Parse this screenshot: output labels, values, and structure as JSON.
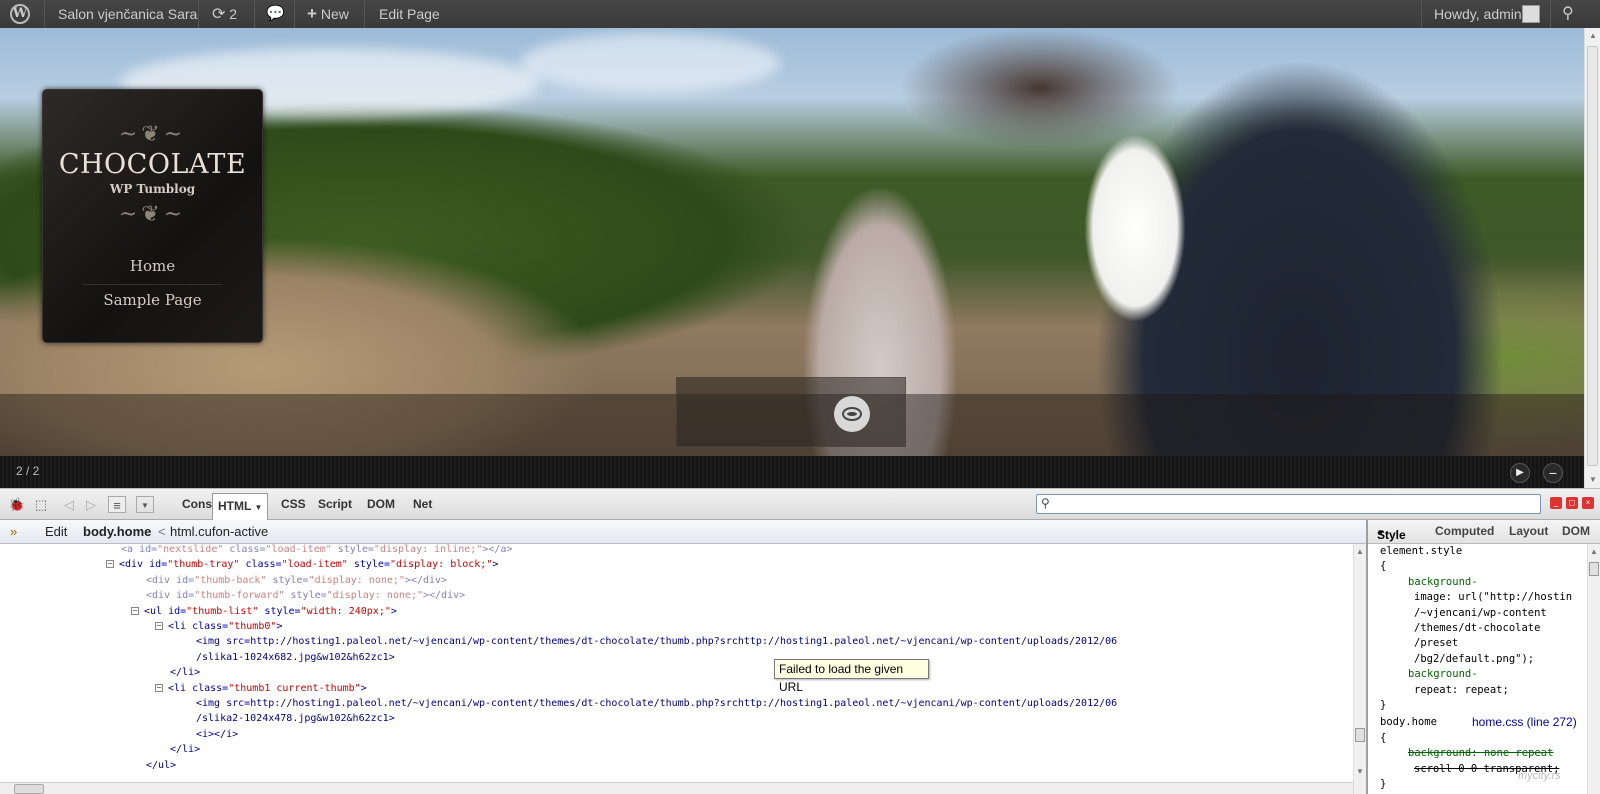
{
  "admin_bar": {
    "site_name": "Salon vjenčanica Sara",
    "updates_count": "2",
    "new_label": "New",
    "edit_label": "Edit Page",
    "greeting": "Howdy, admin"
  },
  "theme": {
    "title": "CHOCOLATE",
    "subtitle": "WP Tumblog",
    "nav": [
      "Home",
      "Sample Page"
    ],
    "slide_counter": "2 / 2"
  },
  "firebug": {
    "tabs": [
      "Console",
      "HTML",
      "CSS",
      "Script",
      "DOM",
      "Net"
    ],
    "active_tab": "HTML",
    "search_value": "",
    "breadcrumb": {
      "edit": "Edit",
      "current": "body.home",
      "sep": "<",
      "parent": "html.cufon-active"
    },
    "side_tabs": [
      "Style",
      "Computed",
      "Layout",
      "DOM"
    ],
    "active_side_tab": "Style",
    "html_lines": [
      {
        "tag": "a",
        "indent": 0,
        "dim": true,
        "text": "<a id=\"nextslide\" class=\"load-item\" style=\"display: inline;\"></a>"
      },
      {
        "tag": "div",
        "indent": 0,
        "toggle": "-",
        "text": "<div id=\"thumb-tray\" class=\"load-item\" style=\"display: block;\">"
      },
      {
        "tag": "div",
        "indent": 1,
        "dim": true,
        "text": "<div id=\"thumb-back\" style=\"display: none;\"></div>"
      },
      {
        "tag": "div",
        "indent": 1,
        "dim": true,
        "text": "<div id=\"thumb-forward\" style=\"display: none;\"></div>"
      },
      {
        "tag": "ul",
        "indent": 1,
        "toggle": "-",
        "text": "<ul id=\"thumb-list\" style=\"width: 240px;\">"
      },
      {
        "tag": "li",
        "indent": 2,
        "toggle": "-",
        "text": "<li class=\"thumb0\">"
      },
      {
        "tag": "img",
        "indent": 3,
        "text": "<img src=\"http://hosting1.paleol.net/~vjencani/wp-content/themes/dt-chocolate/thumb.php?src=http://hosting1.paleol.net/~vjencani/wp-content/uploads/2012/06"
      },
      {
        "tag": "img",
        "indent": 3,
        "text": "/slika1-1024x682.jpg&w=102&h=62zc=1\">"
      },
      {
        "tag": "li",
        "indent": 2,
        "text": "</li>"
      },
      {
        "tag": "li",
        "indent": 2,
        "toggle": "-",
        "text": "<li class=\"thumb1 current-thumb\">"
      },
      {
        "tag": "img",
        "indent": 3,
        "text": "<img src=\"http://hosting1.paleol.net/~vjencani/wp-content/themes/dt-chocolate/thumb.php?src=http://hosting1.paleol.net/~vjencani/wp-content/uploads/2012/06"
      },
      {
        "tag": "img",
        "indent": 3,
        "text": "/slika2-1024x478.jpg&w=102&h=62zc=1\">"
      },
      {
        "tag": "i",
        "indent": 3,
        "text": "<i></i>"
      },
      {
        "tag": "li",
        "indent": 2,
        "text": "</li>"
      },
      {
        "tag": "ul",
        "indent": 1,
        "text": "</ul>"
      }
    ],
    "tooltip": "Failed to load the given URL",
    "style_lines": [
      "element.style",
      "{",
      "background-",
      "image: url(\"http://hostin",
      "/~vjencani/wp-content",
      "/themes/dt-chocolate",
      "/preset",
      "/bg2/default.png\");",
      "background-",
      "repeat: repeat;",
      "}",
      "body.home",
      "{",
      "background: none repeat",
      "scroll 0 0 transparent;",
      "}"
    ],
    "style_source": "home.css (line 272)"
  },
  "watermark": "mycity.rs",
  "colors": {
    "admin_bar": "#464646",
    "firebug_link": "#0000aa"
  }
}
